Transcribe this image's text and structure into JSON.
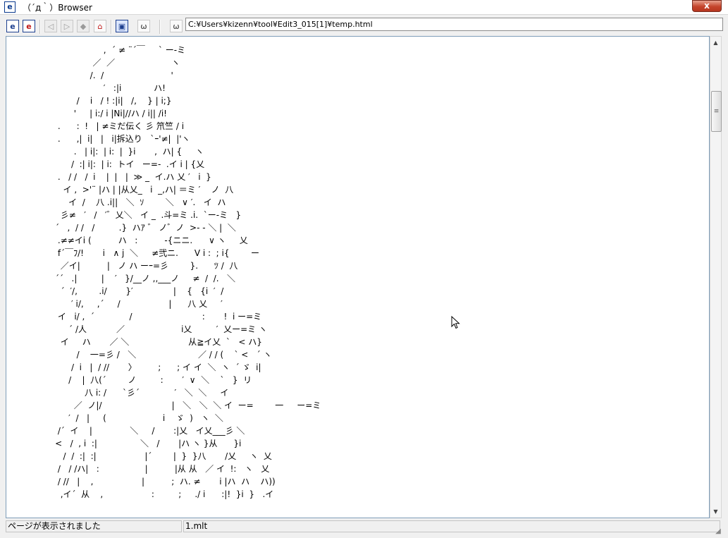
{
  "window": {
    "title": "（´д｀）Browser",
    "app_icon": "e",
    "close_glyph": "x"
  },
  "toolbar": {
    "buttons": [
      {
        "icon": "e-icon",
        "glyph": "e"
      },
      {
        "icon": "e-red-icon",
        "glyph": "e"
      },
      {
        "icon": "back-icon",
        "glyph": "◁"
      },
      {
        "icon": "forward-icon",
        "glyph": "▷"
      },
      {
        "icon": "stop-icon",
        "glyph": "◆"
      },
      {
        "icon": "home-icon",
        "glyph": "⌂"
      },
      {
        "icon": "window-icon",
        "glyph": "▣"
      },
      {
        "icon": "smile-icon",
        "glyph": "ω"
      },
      {
        "icon": "face-icon",
        "glyph": "ω"
      }
    ],
    "address": "C:¥Users¥kizenn¥tool¥Edit3_015[1]¥temp.html"
  },
  "content": {
    "ascii_art": "                       ,  ´ ≠ ¨´￣     ` ー-ミ\n                   ／  ／                     ヽ\n                  /.  /                         '\n                       ′   :|i            ハ!\n             /    i   / ! :|i|   /,    } | i;}\n            '     | i:/ i |Ni|//ハ / i|| /i!\n      .      :  !   | ≠ミだ伝く 彡 笊竺 / i\n      .      ,|  i|   |   i|拆込り   `ｰ'≠|  |'ヽ\n            .   | i|:  | i:  |  }i       ,  ハ| {     ヽ\n           /  :| i|:  | i:  トイ   ー=-  .イ i | {乂\n      .   / /   /  i    |  |   |  ≫ _  イ.ハ 乂 ′   i  }\n        イ ,  >'¨ |ハ | |从乂_   i  _,ハ| ＝ミ ′    ノ  八\n          イ  /    八 .i||   ＼  ｿ        ＼   ∨ ′.   イ  ハ\n       彡≠   ′   /   ′゛乂＼   イ _  .斗=ミ .i.  `ー-ミ   }\n     ´   ,  / /   /         .}  ハｱ ゛ ノ゛ノ  >- ‐ ＼ |  ＼\n      .≠≠イi (          ハ   :          -{ニニ.      ∨ ヽ     乂\n      f´￣ﾌ/!       i   ∧ j  ＼     ≠弐ニ.      V i :  ; i{        ー\n       ／イ|          |   ノ ハ ーｰ=彡        }.      ﾂ /  八\n     ´´   .|         |    ′   }/__ノ ,,___ノ     ≠  /  /.   ＼\n       ´  ′/,        .i/       }′               |    {   {i  ′  /\n           ′ i/,     ,´     /                  |      八 乂     ′\n      イ   i/ ,  ´             /                          :       !  i ー=ミ\n          ´ /人           ／                     i乂         ′  乂ー=ミ ヽ\n       イ     ハ       ／ ＼                      从≧イ乂  `   < ハ}\n             /    一=彡 /   ＼                       ／ / / (    ` <   ´ ヽ\n           /  i   |  / //       〉        ;      ; イ イ  ＼  ヽ  ´ ゞ  i|\n          /    |  八(´        ノ         :       ′  ∨  ＼    `   }  リ\n                八 i: /      `彡´             ′   ＼  ＼     イ\n            ／  ノ|/                          |   ＼   ＼  ＼ イ  ー=        一     ー=ミ\n          ′  /   |     (                     i    ゞ  )   ヽ  ＼\n      /´  イ    |              ＼     /       :|乂   イ乂___彡 ＼\n     <   /  , i  :|                ＼   /       |ハ ヽ }从      }i\n        /  /  :|  :|                  |´        |  }  }八       /乂     ヽ  乂\n      /   / /ハ|   :                 |          |从 从   ／ イ  !:   ヽ   乂\n      / //   |    ,                  |          ;  ハ. ≠       i |ハ  ハ    ハ))\n       ,イ´  从    ,                  :         ;     ./ i      :|!  }i  }   .イ"
  },
  "status": {
    "message": "ページが表示されました",
    "file": "1.mlt"
  },
  "scrollbar": {
    "up_glyph": "▲",
    "down_glyph": "▼",
    "thumb_glyph": "≡"
  }
}
